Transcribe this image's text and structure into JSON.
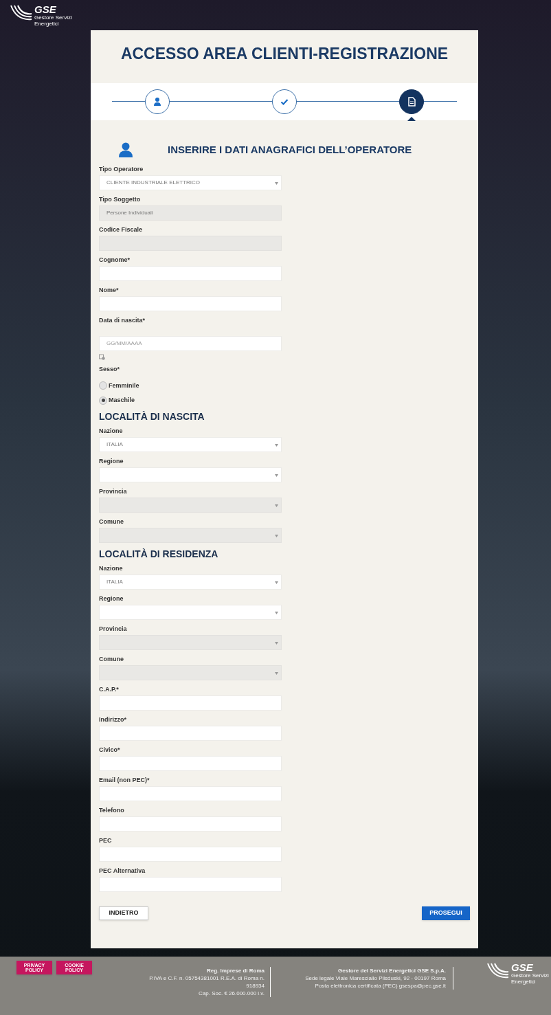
{
  "header": {
    "logo": "GSE",
    "logo_sub": "Gestore Servizi Energetici"
  },
  "title": "ACCESSO AREA CLIENTI-REGISTRAZIONE",
  "steps": [
    {
      "kind": "user",
      "selected": false
    },
    {
      "kind": "check",
      "selected": false
    },
    {
      "kind": "document",
      "selected": true
    }
  ],
  "section_title": "INSERIRE I DATI ANAGRAFICI DELL’OPERATORE",
  "fields": [
    {
      "kind": "select",
      "label": "Tipo Operatore",
      "value": "CLIENTE INDUSTRIALE ELETTRICO",
      "disabled": false
    },
    {
      "kind": "input",
      "label": "Tipo Soggetto",
      "value": "Persone Individuali",
      "disabled": true
    },
    {
      "kind": "input",
      "label": "Codice Fiscale",
      "disabled": true
    },
    {
      "kind": "input",
      "label": "Cognome*",
      "disabled": false
    },
    {
      "kind": "input",
      "label": "Nome*",
      "disabled": false
    },
    {
      "kind": "date",
      "label": "Data di nascita*",
      "placeholder": "GG/MM/AAAA",
      "disabled": false
    },
    {
      "kind": "radio",
      "label": "Sesso*",
      "options": [
        {
          "label": "Femminile",
          "selected": false
        },
        {
          "label": "Maschile",
          "selected": true
        }
      ]
    },
    {
      "kind": "heading",
      "label": "LOCALITÀ DI NASCITA"
    },
    {
      "kind": "select",
      "label": "Nazione",
      "value": "ITALIA",
      "disabled": false
    },
    {
      "kind": "select",
      "label": "Regione",
      "disabled": false
    },
    {
      "kind": "select",
      "label": "Provincia",
      "disabled": true
    },
    {
      "kind": "select",
      "label": "Comune",
      "disabled": true
    },
    {
      "kind": "heading",
      "label": "LOCALITÀ DI RESIDENZA"
    },
    {
      "kind": "select",
      "label": "Nazione",
      "value": "ITALIA",
      "disabled": false
    },
    {
      "kind": "select",
      "label": "Regione",
      "disabled": false
    },
    {
      "kind": "select",
      "label": "Provincia",
      "disabled": true
    },
    {
      "kind": "select",
      "label": "Comune",
      "disabled": true
    },
    {
      "kind": "input",
      "label": "C.A.P.*",
      "disabled": false
    },
    {
      "kind": "input",
      "label": "Indirizzo*",
      "disabled": false
    },
    {
      "kind": "input",
      "label": "Civico*",
      "disabled": false
    },
    {
      "kind": "input",
      "label": "Email (non PEC)*",
      "disabled": false
    },
    {
      "kind": "input",
      "label": "Telefono",
      "disabled": false
    },
    {
      "kind": "input",
      "label": "PEC",
      "disabled": false
    },
    {
      "kind": "input",
      "label": "PEC Alternativa",
      "disabled": false
    }
  ],
  "buttons": {
    "back": "INDIETRO",
    "next": "PROSEGUI"
  },
  "footer": {
    "links": [
      "PRIVACY POLICY",
      "COOKIE POLICY"
    ],
    "block_1": {
      "title": "Reg. Imprese di Roma",
      "lines": [
        "P.IVA e C.F. n. 05754381001 R.E.A. di Roma n. 918934",
        "Cap. Soc. € 26.000.000 i.v."
      ]
    },
    "block_2": {
      "title": "Gestore dei Servizi Energetici GSE S.p.A.",
      "lines": [
        "Sede legale Viale Maresciallo Pilsduski, 92 - 00197 Roma",
        "Posta elettronica certificata (PEC) gsespa@pec.gse.it"
      ]
    },
    "logo": "GSE",
    "logo_sub": "Gestore Servizi Energetici"
  }
}
